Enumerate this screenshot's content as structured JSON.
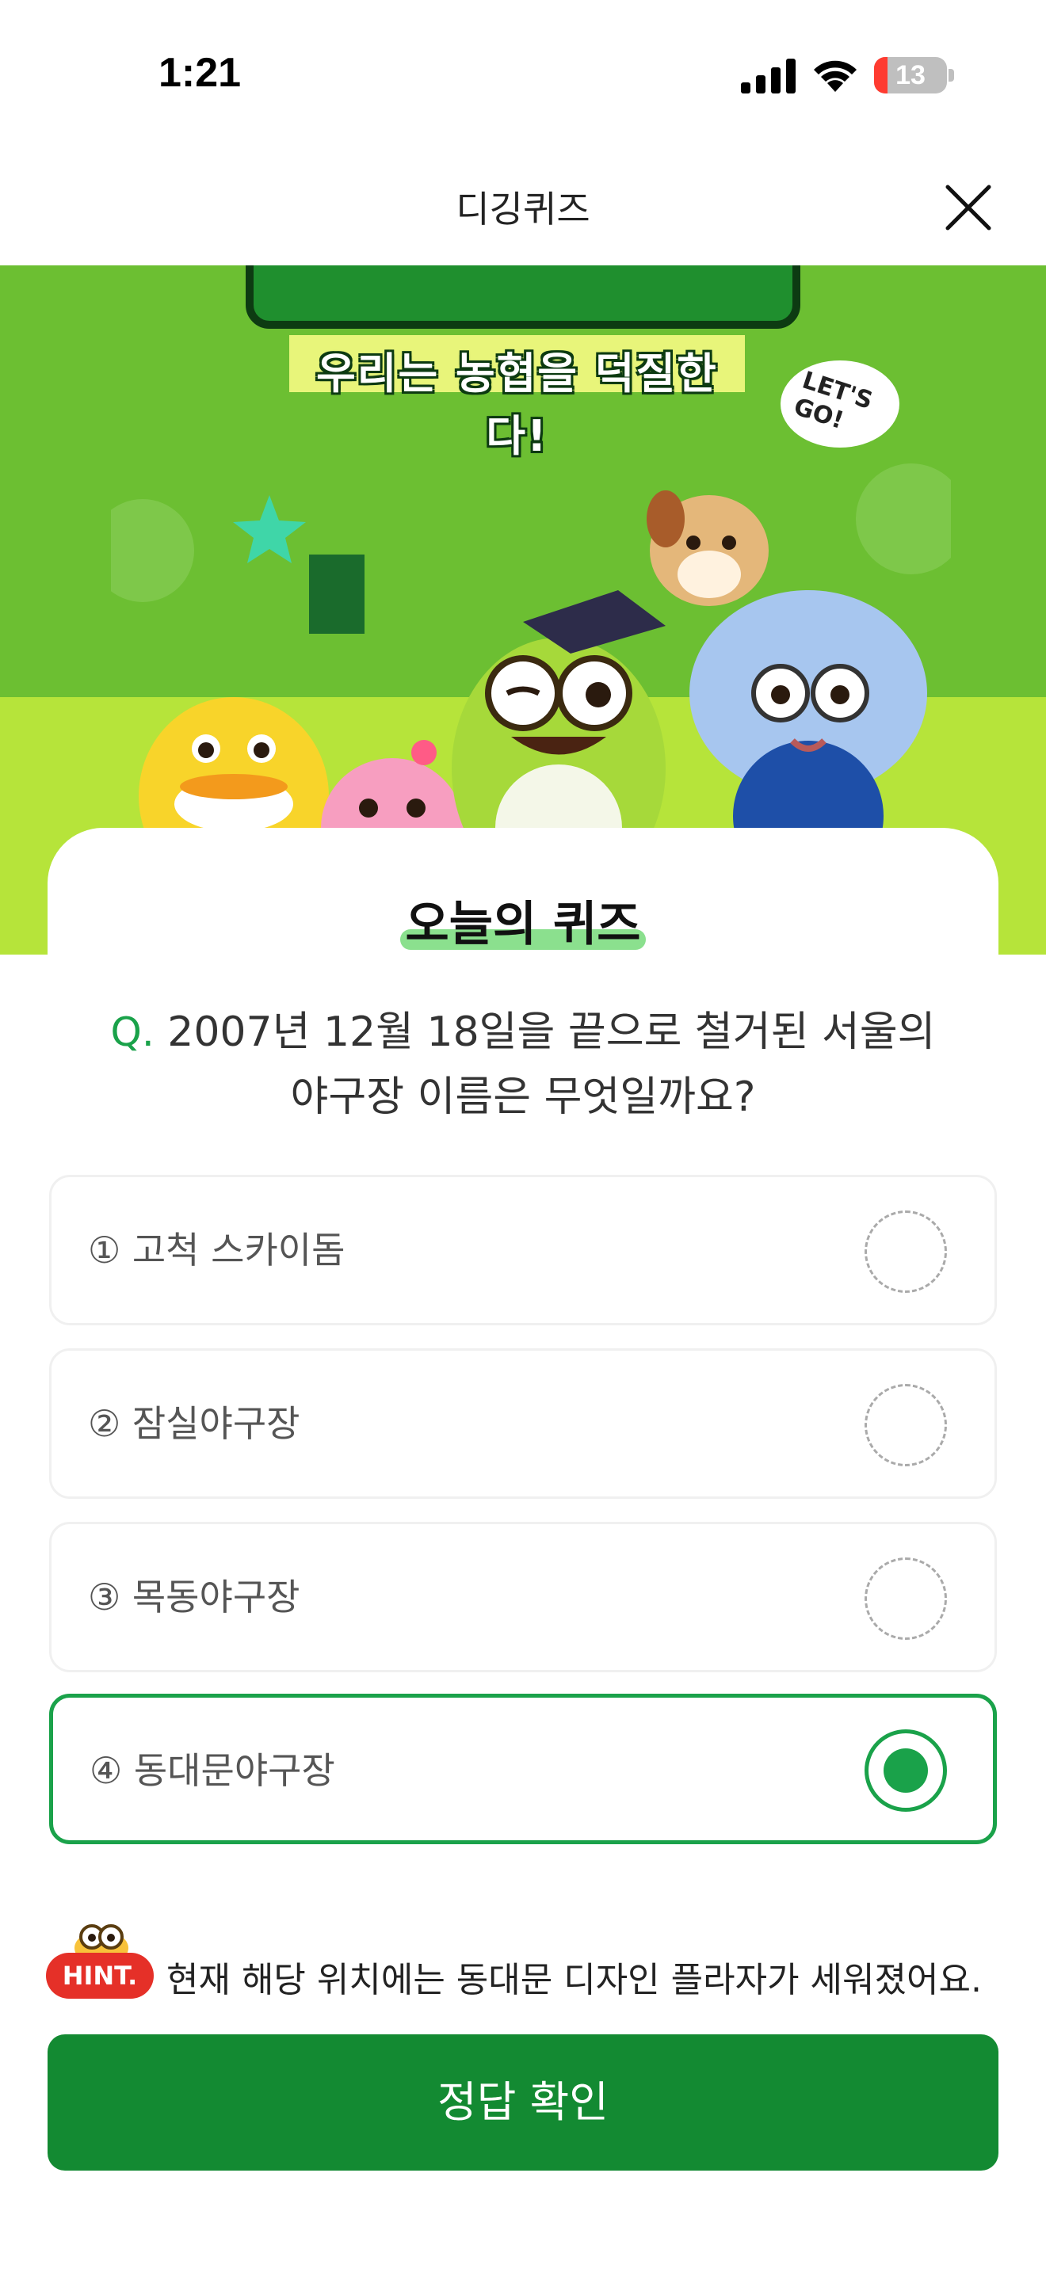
{
  "status_bar": {
    "time": "1:21",
    "battery_level": "13"
  },
  "header": {
    "title": "디깅퀴즈"
  },
  "banner": {
    "subtitle": "우리는 농협을 덕질한다!",
    "bubble_text": "LET'S GO!"
  },
  "card": {
    "heading": "오늘의 퀴즈",
    "question_prefix": "Q.",
    "question_line1": "2007년 12월 18일을 끝으로 철거된 서울의",
    "question_line2": "야구장 이름은 무엇일까요?"
  },
  "options": [
    {
      "label": "① 고척 스카이돔",
      "selected": false
    },
    {
      "label": "② 잠실야구장",
      "selected": false
    },
    {
      "label": "③ 목동야구장",
      "selected": false
    },
    {
      "label": "④ 동대문야구장",
      "selected": true
    }
  ],
  "hint": {
    "badge": "HINT.",
    "text": "현재 해당 위치에는 동대문 디자인 플라자가 세워졌어요."
  },
  "confirm_button": {
    "label": "정답 확인"
  },
  "colors": {
    "accent": "#1aa24a",
    "button": "#138a32",
    "hint_badge": "#e53028",
    "banner_green": "#6cbf32",
    "banner_lime": "#b6e43a"
  },
  "icons": {
    "close": "close-icon",
    "signal": "cellular-signal-icon",
    "wifi": "wifi-icon",
    "battery": "battery-icon"
  }
}
